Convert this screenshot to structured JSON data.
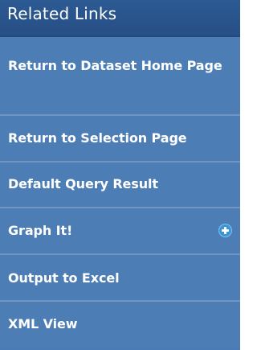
{
  "panel": {
    "title": "Related Links",
    "links": [
      {
        "label": "Return to Dataset Home Page"
      },
      {
        "label": "Return to Selection Page"
      },
      {
        "label": "Default Query Result"
      },
      {
        "label": "Graph It!",
        "icon": "plus-circle-icon"
      },
      {
        "label": "Output to Excel"
      },
      {
        "label": "XML View"
      }
    ]
  },
  "colors": {
    "header_background": "#2c5a93",
    "item_background": "#4d7db5",
    "divider": "#6f95c5",
    "text": "#ffffff",
    "icon_background": "#3d95d6"
  }
}
